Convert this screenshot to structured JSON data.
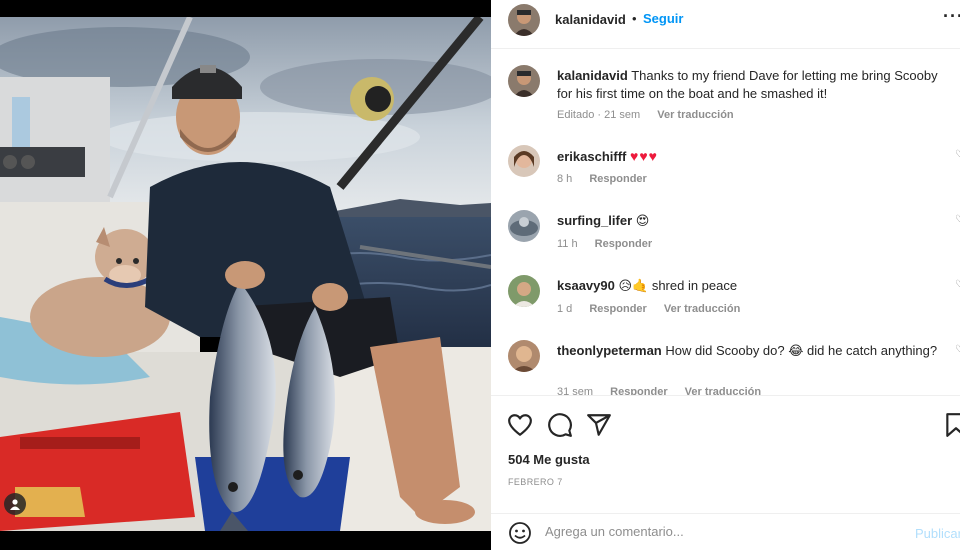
{
  "post": {
    "username": "kalanidavid",
    "follow_label": "Seguir",
    "separator": "•",
    "more_label": "···"
  },
  "caption": {
    "username": "kalanidavid",
    "text": "Thanks to my friend Dave for letting me bring Scooby for his first time on the boat and he smashed it!",
    "edited": "Editado",
    "time": "21 sem",
    "translate": "Ver traducción"
  },
  "comments": [
    {
      "username": "erikaschifff",
      "text": "",
      "emoji": "♥♥♥",
      "time": "8 h",
      "reply": "Responder",
      "translate": ""
    },
    {
      "username": "surfing_lifer",
      "text": "",
      "emoji": "😍",
      "time": "11 h",
      "reply": "Responder",
      "translate": ""
    },
    {
      "username": "ksaavy90",
      "text": "😥🤙 shred in peace",
      "emoji": "",
      "time": "1 d",
      "reply": "Responder",
      "translate": "Ver traducción"
    },
    {
      "username": "theonlypeterman",
      "text": "How did Scooby do? 😂 did he catch anything?",
      "emoji": "",
      "time": "31 sem",
      "reply": "Responder",
      "translate": "Ver traducción"
    }
  ],
  "stats": {
    "likes": "504 Me gusta",
    "date": "FEBRERO 7"
  },
  "add_comment": {
    "placeholder": "Agrega un comentario...",
    "publish": "Publicar"
  },
  "colors": {
    "accent": "#0095f6",
    "heart": "#ed1a3c",
    "muted": "#8e8e8e",
    "publish_disabled": "#b2dffc"
  },
  "icons": [
    "heart-icon",
    "comment-icon",
    "share-icon",
    "bookmark-icon",
    "emoji-icon",
    "user-tag-icon",
    "more-icon"
  ]
}
